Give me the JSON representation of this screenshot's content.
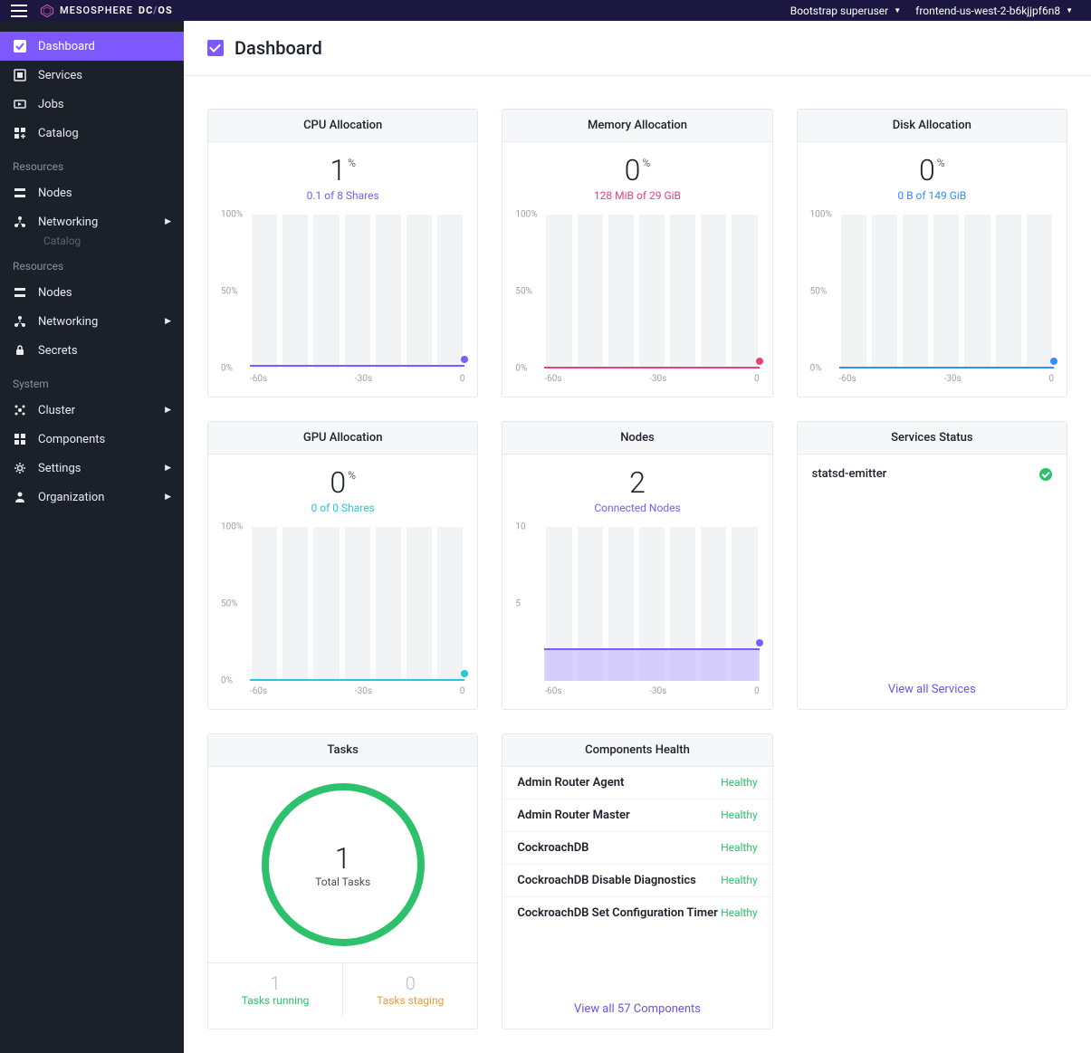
{
  "topbar": {
    "brand_prefix": "MESOSPHERE",
    "brand_dc": "DC",
    "brand_os": "OS",
    "user_label": "Bootstrap superuser",
    "cluster_label": "frontend-us-west-2-b6kjjpf6n8"
  },
  "sidebar": {
    "items_primary": [
      {
        "label": "Dashboard",
        "active": true
      },
      {
        "label": "Services"
      },
      {
        "label": "Jobs"
      },
      {
        "label": "Catalog"
      }
    ],
    "section_resources": "Resources",
    "items_resources1": [
      {
        "label": "Nodes"
      },
      {
        "label": "Networking",
        "expandable": true
      }
    ],
    "section_resources2": "Resources",
    "ghost_label": "Catalog",
    "items_resources2": [
      {
        "label": "Nodes"
      },
      {
        "label": "Networking",
        "expandable": true
      },
      {
        "label": "Secrets"
      }
    ],
    "section_system": "System",
    "items_system": [
      {
        "label": "Cluster",
        "expandable": true
      },
      {
        "label": "Components"
      },
      {
        "label": "Settings",
        "expandable": true
      },
      {
        "label": "Organization",
        "expandable": true
      }
    ]
  },
  "page": {
    "title": "Dashboard"
  },
  "panels": {
    "cpu": {
      "title": "CPU Allocation",
      "value": "1",
      "unit": "%",
      "sub": "0.1 of 8 Shares",
      "color": "#7a5cff"
    },
    "mem": {
      "title": "Memory Allocation",
      "value": "0",
      "unit": "%",
      "sub": "128 MiB of 29 GiB",
      "color": "#e8407f"
    },
    "disk": {
      "title": "Disk Allocation",
      "value": "0",
      "unit": "%",
      "sub": "0 B of 149 GiB",
      "color": "#2f8fff"
    },
    "gpu": {
      "title": "GPU Allocation",
      "value": "0",
      "unit": "%",
      "sub": "0 of 0 Shares",
      "color": "#28c7d9"
    },
    "nodes": {
      "title": "Nodes",
      "value": "2",
      "sub": "Connected Nodes",
      "color": "#7a5cff"
    },
    "svc": {
      "title": "Services Status",
      "item": "statsd-emitter",
      "link": "View all Services"
    },
    "tasks": {
      "title": "Tasks",
      "total_n": "1",
      "total_label": "Total Tasks",
      "running_n": "1",
      "running_label": "Tasks running",
      "staging_n": "0",
      "staging_label": "Tasks staging"
    },
    "comp": {
      "title": "Components Health",
      "rows": [
        {
          "name": "Admin Router Agent",
          "status": "Healthy"
        },
        {
          "name": "Admin Router Master",
          "status": "Healthy"
        },
        {
          "name": "CockroachDB",
          "status": "Healthy"
        },
        {
          "name": "CockroachDB Disable Diagnostics",
          "status": "Healthy"
        },
        {
          "name": "CockroachDB Set Configuration Timer",
          "status": "Healthy"
        }
      ],
      "link": "View all 57 Components"
    }
  },
  "axis": {
    "y100": "100%",
    "y50": "50%",
    "y0": "0%",
    "y10": "10",
    "y5": "5",
    "x0": "-60s",
    "x1": "-30s",
    "x2": "0"
  },
  "chart_data": [
    {
      "type": "line",
      "title": "CPU Allocation",
      "x_range_seconds": [
        -60,
        0
      ],
      "ylim_percent": [
        0,
        100
      ],
      "approx_value_percent": 1,
      "series": [
        {
          "name": "cpu",
          "flat_value": 1
        }
      ]
    },
    {
      "type": "line",
      "title": "Memory Allocation",
      "x_range_seconds": [
        -60,
        0
      ],
      "ylim_percent": [
        0,
        100
      ],
      "approx_value_percent": 0,
      "series": [
        {
          "name": "memory",
          "flat_value": 0
        }
      ]
    },
    {
      "type": "line",
      "title": "Disk Allocation",
      "x_range_seconds": [
        -60,
        0
      ],
      "ylim_percent": [
        0,
        100
      ],
      "approx_value_percent": 0,
      "series": [
        {
          "name": "disk",
          "flat_value": 0
        }
      ]
    },
    {
      "type": "line",
      "title": "GPU Allocation",
      "x_range_seconds": [
        -60,
        0
      ],
      "ylim_percent": [
        0,
        100
      ],
      "approx_value_percent": 0,
      "series": [
        {
          "name": "gpu",
          "flat_value": 0
        }
      ]
    },
    {
      "type": "area",
      "title": "Nodes",
      "x_range_seconds": [
        -60,
        0
      ],
      "ylim": [
        0,
        10
      ],
      "series": [
        {
          "name": "connected_nodes",
          "flat_value": 2
        }
      ]
    },
    {
      "type": "pie",
      "title": "Tasks",
      "slices": [
        {
          "label": "Tasks running",
          "value": 1
        },
        {
          "label": "Tasks staging",
          "value": 0
        }
      ],
      "total": 1
    }
  ]
}
